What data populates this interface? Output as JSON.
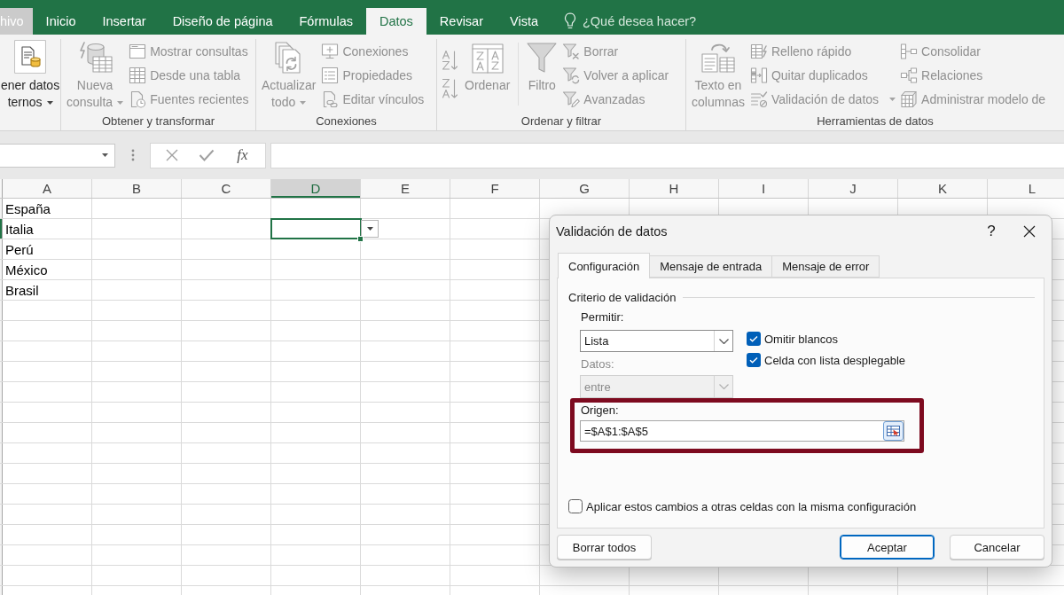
{
  "ribbon_tabs": [
    {
      "label": "hivo",
      "kind": "file",
      "selected": false
    },
    {
      "label": "Inicio",
      "kind": "tab",
      "selected": false
    },
    {
      "label": "Insertar",
      "kind": "tab",
      "selected": false
    },
    {
      "label": "Diseño de página",
      "kind": "tab",
      "selected": false
    },
    {
      "label": "Fórmulas",
      "kind": "tab",
      "selected": false
    },
    {
      "label": "Datos",
      "kind": "tab",
      "selected": true
    },
    {
      "label": "Revisar",
      "kind": "tab",
      "selected": false
    },
    {
      "label": "Vista",
      "kind": "tab",
      "selected": false
    }
  ],
  "tell_me": {
    "placeholder": "¿Qué desea hacer?"
  },
  "ribbon_groups": [
    {
      "items": [
        {
          "kind": "large",
          "lines": [
            "ener datos",
            "ternos"
          ],
          "dropdown": true,
          "disabled": false
        }
      ]
    },
    {
      "label": "Obtener y transformar",
      "items": [
        {
          "kind": "large",
          "lines": [
            "Nueva",
            "consulta"
          ],
          "dropdown": true,
          "disabled": true
        },
        {
          "kind": "stack",
          "buttons": [
            {
              "label": "Mostrar consultas",
              "disabled": true
            },
            {
              "label": "Desde una tabla",
              "disabled": true
            },
            {
              "label": "Fuentes recientes",
              "disabled": true
            }
          ]
        }
      ]
    },
    {
      "label": "Conexiones",
      "items": [
        {
          "kind": "large",
          "lines": [
            "Actualizar",
            "todo"
          ],
          "dropdown": true,
          "disabled": true
        },
        {
          "kind": "stack",
          "buttons": [
            {
              "label": "Conexiones",
              "disabled": true
            },
            {
              "label": "Propiedades",
              "disabled": true
            },
            {
              "label": "Editar vínculos",
              "disabled": true
            }
          ]
        }
      ]
    },
    {
      "label": "Ordenar y filtrar",
      "items": [
        {
          "kind": "icon_stack",
          "buttons": [
            {
              "disabled": true
            },
            {
              "disabled": true
            }
          ]
        },
        {
          "kind": "large",
          "lines": [
            "Ordenar"
          ],
          "disabled": true
        },
        {
          "kind": "large",
          "lines": [
            "Filtro"
          ],
          "disabled": true
        },
        {
          "kind": "stack",
          "buttons": [
            {
              "label": "Borrar",
              "disabled": true
            },
            {
              "label": "Volver a aplicar",
              "disabled": true
            },
            {
              "label": "Avanzadas",
              "disabled": true
            }
          ]
        }
      ]
    },
    {
      "label": "Herramientas de datos",
      "items": [
        {
          "kind": "large",
          "lines": [
            "Texto en",
            "columnas"
          ],
          "disabled": true
        },
        {
          "kind": "stack",
          "buttons": [
            {
              "label": "Relleno rápido",
              "disabled": true
            },
            {
              "label": "Quitar duplicados",
              "disabled": true
            },
            {
              "label": "Validación de datos",
              "dropdown": true,
              "disabled": true
            }
          ]
        },
        {
          "kind": "stack",
          "buttons": [
            {
              "label": "Consolidar",
              "disabled": true
            },
            {
              "label": "Relaciones",
              "disabled": true
            },
            {
              "label": "Administrar modelo de",
              "disabled": true
            }
          ]
        }
      ]
    }
  ],
  "formula_bar": {
    "function_label": "fx"
  },
  "sheet": {
    "columns": [
      {
        "label": "A",
        "selected": false
      },
      {
        "label": "B",
        "selected": false
      },
      {
        "label": "C",
        "selected": false
      },
      {
        "label": "D",
        "selected": true
      },
      {
        "label": "E",
        "selected": false
      },
      {
        "label": "F",
        "selected": false
      },
      {
        "label": "G",
        "selected": false
      },
      {
        "label": "H",
        "selected": false
      },
      {
        "label": "I",
        "selected": false
      },
      {
        "label": "J",
        "selected": false
      },
      {
        "label": "K",
        "selected": false
      },
      {
        "label": "L",
        "selected": false
      }
    ],
    "rows": [
      {
        "cells": [
          "España"
        ],
        "selected": false
      },
      {
        "cells": [
          "Italia"
        ],
        "selected": true
      },
      {
        "cells": [
          "Perú"
        ],
        "selected": false
      },
      {
        "cells": [
          "México"
        ],
        "selected": false
      },
      {
        "cells": [
          "Brasil"
        ],
        "selected": false
      }
    ],
    "active_cell_dropdown": true
  },
  "dialog": {
    "title": "Validación de datos",
    "help_button": "?",
    "tabs": [
      {
        "label": "Configuración",
        "selected": true
      },
      {
        "label": "Mensaje de entrada",
        "selected": false
      },
      {
        "label": "Mensaje de error",
        "selected": false
      }
    ],
    "section_title": "Criterio de validación",
    "allow": {
      "label": "Permitir:",
      "value": "Lista",
      "disabled": false
    },
    "data": {
      "label": "Datos:",
      "value": "entre",
      "disabled": true
    },
    "options": [
      {
        "label": "Omitir blancos",
        "checked": true
      },
      {
        "label": "Celda con lista desplegable",
        "checked": true
      }
    ],
    "source": {
      "label": "Origen:",
      "value": "=$A$1:$A$5",
      "highlighted": true
    },
    "apply_all": {
      "label": "Aplicar estos cambios a otras celdas con la misma configuración",
      "checked": false
    },
    "buttons": [
      {
        "label": "Borrar todos",
        "kind": "reset"
      },
      {
        "label": "Aceptar",
        "kind": "primary"
      },
      {
        "label": "Cancelar",
        "kind": "cancel"
      }
    ]
  }
}
